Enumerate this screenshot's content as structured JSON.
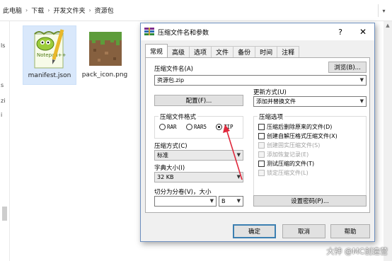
{
  "explorer": {
    "breadcrumb": [
      "此电脑",
      "下载",
      "开发文件夹",
      "资源包"
    ],
    "left_marks": [
      "ls",
      "s",
      "zi",
      "i"
    ],
    "files": [
      {
        "name": "manifest.json",
        "icon": "notepad-plus-plus-icon",
        "selected": true
      },
      {
        "name": "pack_icon.png",
        "icon": "minecraft-grass-block-icon",
        "selected": false
      }
    ]
  },
  "dialog": {
    "title": "压缩文件名和参数",
    "help": "?",
    "close": "✕",
    "tabs": [
      "常规",
      "高级",
      "选项",
      "文件",
      "备份",
      "时间",
      "注释"
    ],
    "active_tab": "常规",
    "archive_name_label": "压缩文件名(A)",
    "browse_button": "浏览(B)...",
    "archive_name_value": "资源包.zip",
    "update_mode_label": "更新方式(U)",
    "update_mode_value": "添加并替换文件",
    "profiles_button": "配置(F)...",
    "format_group_title": "压缩文件格式",
    "formats": [
      {
        "label": "RAR",
        "selected": false
      },
      {
        "label": "RAR5",
        "selected": false
      },
      {
        "label": "ZIP",
        "selected": true
      }
    ],
    "method_label": "压缩方式(C)",
    "method_value": "标准",
    "dict_label": "字典大小(I)",
    "dict_value": "32 KB",
    "split_label": "切分为分卷(V)，大小",
    "split_value": "",
    "split_unit": "B",
    "options_group_title": "压缩选项",
    "options": [
      {
        "label": "压缩后删除原来的文件(D)",
        "checked": false,
        "disabled": false
      },
      {
        "label": "创建自解压格式压缩文件(X)",
        "checked": false,
        "disabled": false
      },
      {
        "label": "创建固实压缩文件(S)",
        "checked": false,
        "disabled": true
      },
      {
        "label": "添加恢复记录(E)",
        "checked": false,
        "disabled": true
      },
      {
        "label": "测试压缩的文件(T)",
        "checked": false,
        "disabled": false
      },
      {
        "label": "锁定压缩文件(L)",
        "checked": false,
        "disabled": true
      }
    ],
    "password_button": "设置密码(P)...",
    "ok_button": "确定",
    "cancel_button": "取消",
    "help_button": "帮助"
  },
  "watermark": "大神 @MC创造营",
  "colors": {
    "annotation_arrow": "#e0283c",
    "selection": "#d9e8fb",
    "dialog_border": "#6d8fbf"
  }
}
